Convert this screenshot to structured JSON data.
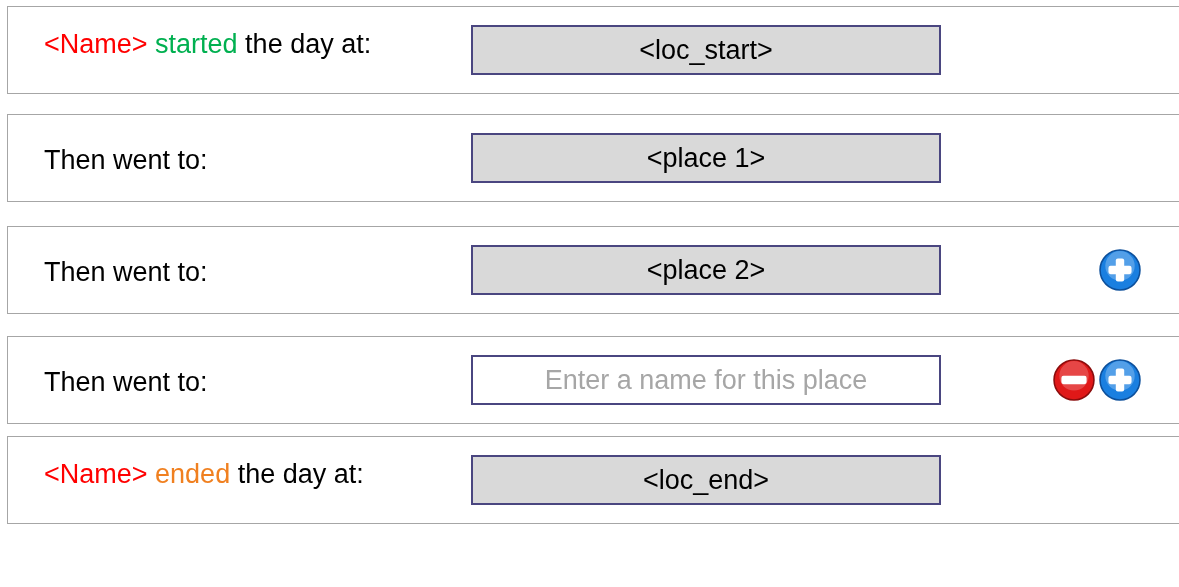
{
  "rows": [
    {
      "kind": "start",
      "label": [
        {
          "text": "<Name>",
          "color": "#ff0000"
        },
        {
          "text": " started",
          "color": "#00b050"
        },
        {
          "text": " the day at:",
          "color": "#000000"
        }
      ],
      "field": {
        "value": "<loc_start>"
      },
      "remove_button": false,
      "add_button": false
    },
    {
      "kind": "stop",
      "label": [
        {
          "text": "Then went to:",
          "color": "#000000"
        }
      ],
      "field": {
        "value": "<place 1>"
      },
      "remove_button": false,
      "add_button": false
    },
    {
      "kind": "stop",
      "label": [
        {
          "text": "Then went to:",
          "color": "#000000"
        }
      ],
      "field": {
        "value": "<place 2>"
      },
      "remove_button": false,
      "add_button": true
    },
    {
      "kind": "stop",
      "label": [
        {
          "text": "Then went to:",
          "color": "#000000"
        }
      ],
      "field": {
        "placeholder": "Enter a name for this place"
      },
      "remove_button": true,
      "add_button": true
    },
    {
      "kind": "end",
      "label": [
        {
          "text": "<Name>",
          "color": "#ff0000"
        },
        {
          "text": " ended",
          "color": "#f08020"
        },
        {
          "text": " the day at:",
          "color": "#000000"
        }
      ],
      "field": {
        "value": "<loc_end>"
      },
      "remove_button": false,
      "add_button": false
    }
  ]
}
